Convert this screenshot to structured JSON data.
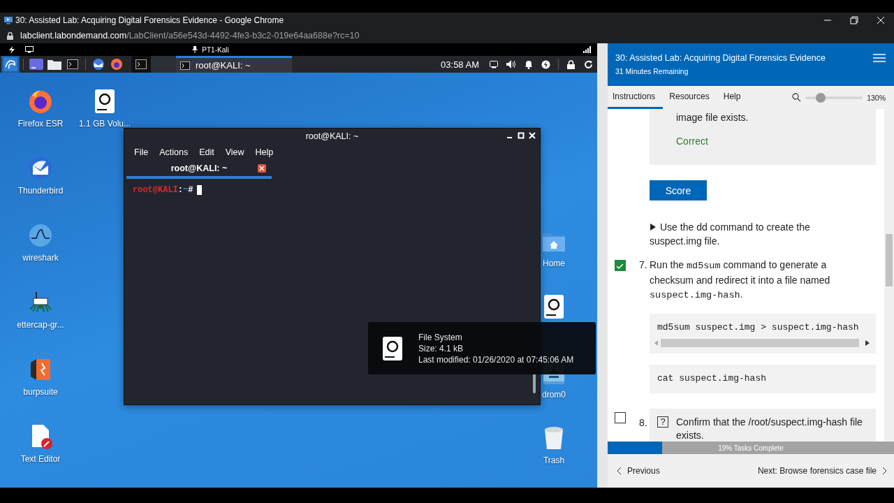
{
  "browser": {
    "title": "30: Assisted Lab: Acquiring Digital Forensics Evidence - Google Chrome",
    "url_host": "labclient.labondemand.com",
    "url_path": "/LabClient/a56e543d-4492-4fe3-b3c2-019e64aa688e?rc=10"
  },
  "vm_top_bar": {
    "title": "PT1-Kali"
  },
  "taskbar": {
    "task": {
      "label": "root@KALI: ~",
      "selected": true
    },
    "clock": "03:58 AM"
  },
  "desktop": {
    "left_columns": [
      [
        {
          "kind": "firefox",
          "label": "Firefox ESR"
        },
        {
          "kind": "thunderbird",
          "label": "Thunderbird"
        },
        {
          "kind": "wireshark",
          "label": "wireshark"
        },
        {
          "kind": "ettercap",
          "label": "ettercap-gr..."
        },
        {
          "kind": "burpsuite",
          "label": "burpsuite"
        },
        {
          "kind": "text-editor",
          "label": "Text Editor"
        }
      ],
      [
        {
          "kind": "drive",
          "label": "1.1 GB Volu..."
        }
      ]
    ],
    "right_column": [
      {
        "kind": "home",
        "label": "Home"
      },
      {
        "kind": "drive"
      },
      {
        "kind": "cdrom",
        "label": "drom0"
      },
      {
        "kind": "trash",
        "label": "Trash"
      }
    ]
  },
  "terminal": {
    "title": "root@KALI: ~",
    "menu": [
      "File",
      "Actions",
      "Edit",
      "View",
      "Help"
    ],
    "tabs": [
      {
        "label": "root@KALI: ~",
        "selected": true
      }
    ],
    "prompt": {
      "user": "root@KALI",
      "separator": ":",
      "path": "~",
      "symbol": "#"
    }
  },
  "tooltip": {
    "name": "File System",
    "size": "Size: 4.1 kB",
    "modified": "Last modified: 01/26/2020 at 07:45:06 AM"
  },
  "lab_panel": {
    "title": "30: Assisted Lab: Acquiring Digital Forensics Evidence",
    "time_remaining": "31 Minutes Remaining",
    "tabs": [
      {
        "label": "Instructions",
        "selected": true
      },
      {
        "label": "Resources",
        "selected": false
      },
      {
        "label": "Help",
        "selected": false
      }
    ],
    "zoom": {
      "level": 0.27,
      "reading": "130%"
    },
    "content": [
      {
        "kind": "result",
        "text": "image file exists.",
        "status": "Correct"
      },
      {
        "kind": "button",
        "label": "Score"
      },
      {
        "kind": "hint",
        "expanded": false,
        "text": "Use the dd command to create the suspect.img file."
      },
      {
        "kind": "step",
        "number": "7.",
        "checked": true,
        "segments": [
          {
            "kind": "text",
            "text": "Run the "
          },
          {
            "kind": "code",
            "text": "md5sum"
          },
          {
            "kind": "text",
            "text": " command to generate a checksum and redirect it into a file named "
          },
          {
            "kind": "code",
            "text": "suspect.img-hash"
          },
          {
            "kind": "text",
            "text": "."
          }
        ],
        "code_blocks": [
          {
            "text": "md5sum suspect.img > suspect.img-hash",
            "scrollbar": true
          },
          {
            "text": "cat suspect.img-hash",
            "scrollbar": false
          }
        ]
      },
      {
        "kind": "question",
        "number": "8.",
        "checked": false,
        "badge": "?",
        "text": "Confirm that the /root/suspect.img-hash file exists."
      }
    ],
    "progress": {
      "level": 0.19,
      "label": "19% Tasks Complete"
    },
    "previous": "Previous",
    "next": "Next: Browse forensics case file"
  }
}
